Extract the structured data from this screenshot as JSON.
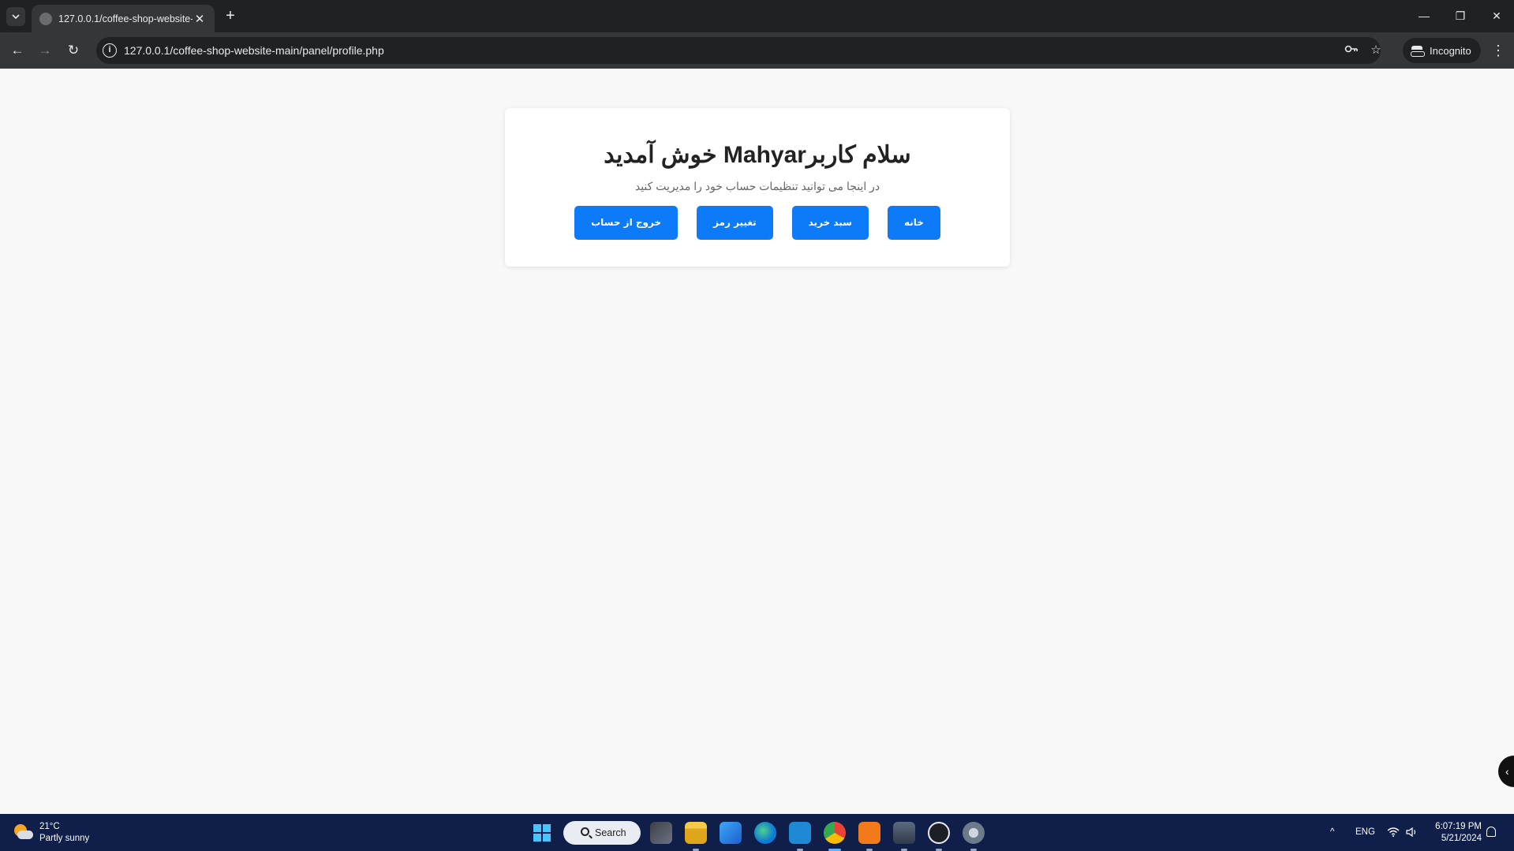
{
  "browser": {
    "tab_title": "127.0.0.1/coffee-shop-website-",
    "tab_close": "✕",
    "new_tab": "+",
    "url": "127.0.0.1/coffee-shop-website-main/panel/profile.php",
    "incognito_label": "Incognito",
    "window_controls": {
      "minimize": "—",
      "restore": "❐",
      "close": "✕"
    },
    "nav": {
      "back": "←",
      "forward": "→",
      "reload": "↻",
      "menu": "⋮"
    }
  },
  "page": {
    "welcome": "سلام کاربرMahyar خوش آمدید",
    "subtitle": "در اینجا می توانید تنظیمات حساب خود را مدیریت کنید",
    "buttons": {
      "home": "خانه",
      "cart": "سبد خرید",
      "change_password": "تغییر رمز",
      "logout": "خروج از حساب"
    },
    "side_widget": "‹"
  },
  "taskbar": {
    "weather_temp": "21°C",
    "weather_desc": "Partly sunny",
    "search_label": "Search",
    "language": "ENG",
    "time": "6:07:19 PM",
    "date": "5/21/2024",
    "tray_chevron": "^"
  },
  "colors": {
    "primary_button": "#0d7bf7",
    "taskbar": "#0f1f4a",
    "chrome_dark": "#202124",
    "chrome_toolbar": "#35363a"
  }
}
